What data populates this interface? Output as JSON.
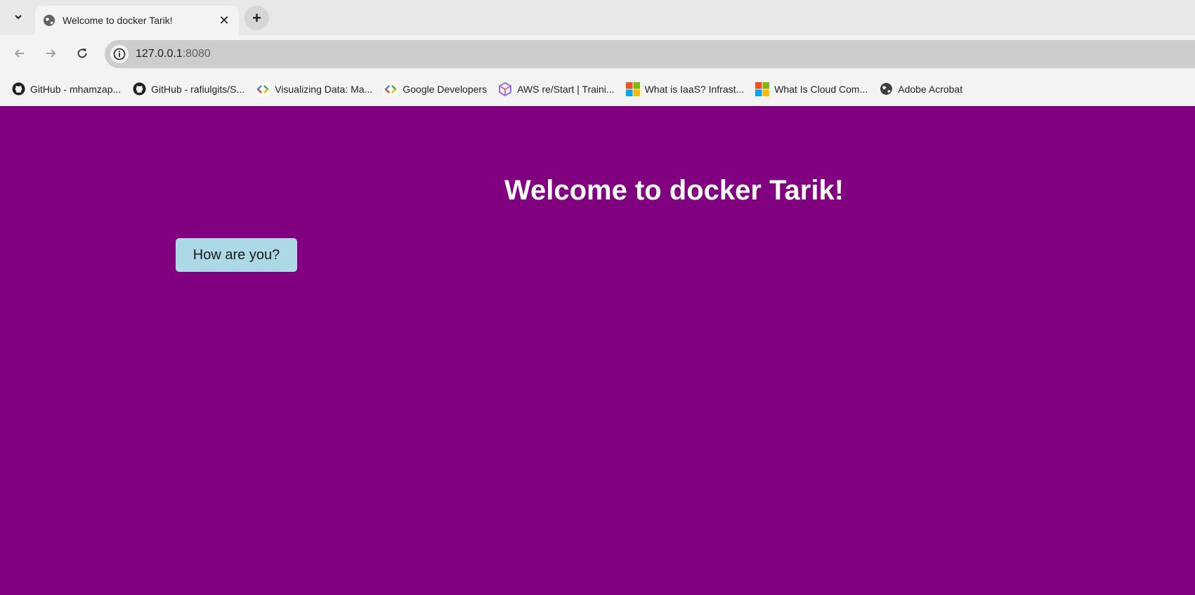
{
  "browser": {
    "tab": {
      "title": "Welcome to docker Tarik!"
    },
    "address": {
      "host": "127.0.0.1",
      "port": ":8080"
    },
    "bookmarks": [
      {
        "label": "GitHub - mhamzap...",
        "icon": "github-icon"
      },
      {
        "label": "GitHub - rafiulgits/S...",
        "icon": "github-icon"
      },
      {
        "label": "Visualizing Data: Ma...",
        "icon": "code-icon"
      },
      {
        "label": "Google Developers",
        "icon": "code-icon"
      },
      {
        "label": "AWS re/Start | Traini...",
        "icon": "cube-icon"
      },
      {
        "label": "What is IaaS? Infrast...",
        "icon": "microsoft-icon"
      },
      {
        "label": "What Is Cloud Com...",
        "icon": "microsoft-icon"
      },
      {
        "label": "Adobe Acrobat",
        "icon": "globe-icon"
      }
    ]
  },
  "page": {
    "heading": "Welcome to docker Tarik!",
    "button_label": "How are you?",
    "background_color": "#800080",
    "button_color": "#add8e6"
  }
}
